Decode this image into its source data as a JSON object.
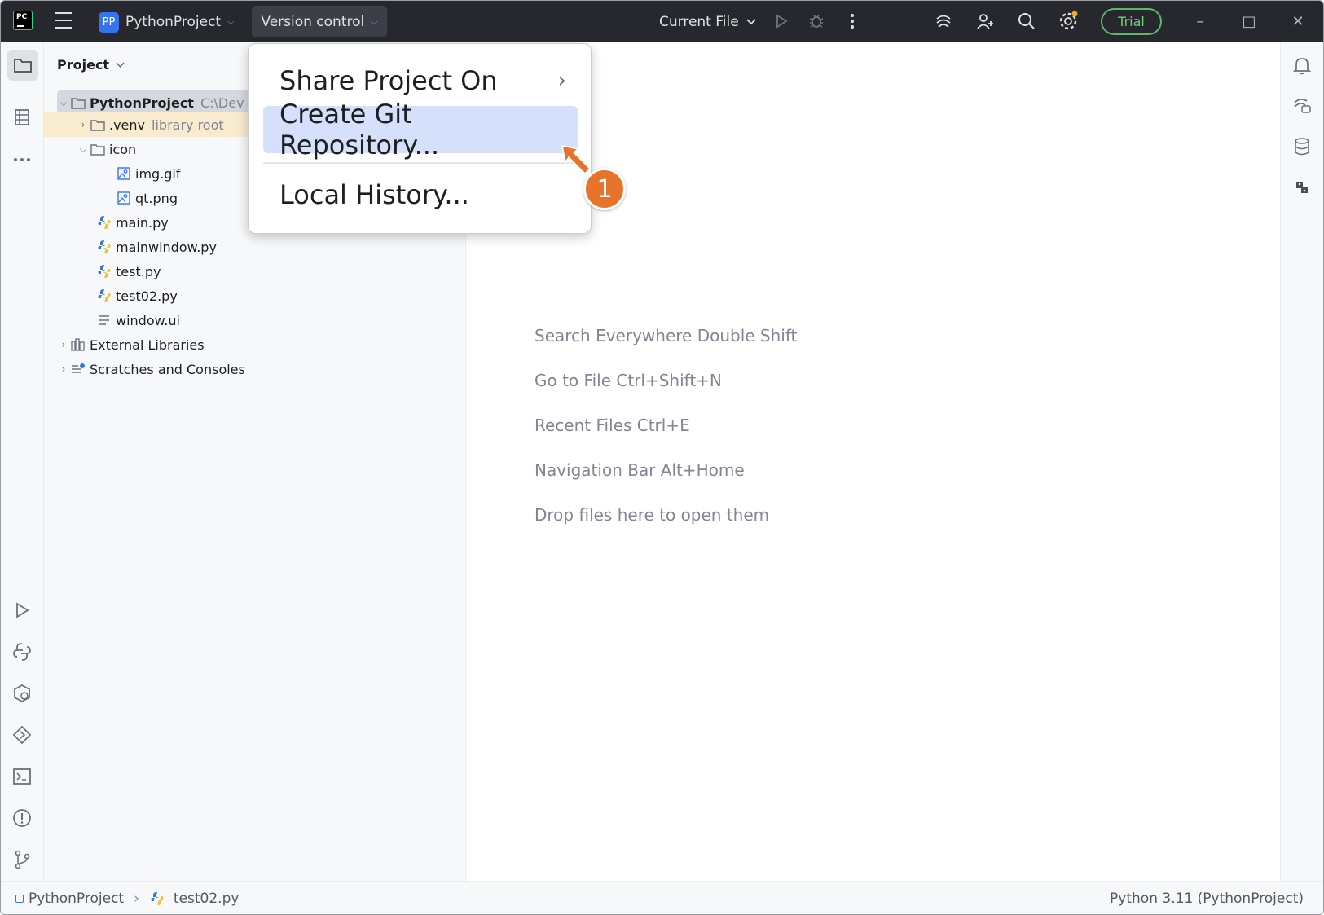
{
  "titlebar": {
    "logo_text": "PC",
    "project_badge": "PP",
    "project_name": "PythonProject",
    "vcs_label": "Version control",
    "run_config": "Current File",
    "trial_label": "Trial"
  },
  "project_panel": {
    "title": "Project",
    "tree": [
      {
        "name": "PythonProject",
        "extra": "C:\\Dev",
        "type": "folder"
      },
      {
        "name": ".venv",
        "extra": "library root",
        "type": "folder"
      },
      {
        "name": "icon",
        "type": "folder"
      },
      {
        "name": "img.gif",
        "type": "image"
      },
      {
        "name": "qt.png",
        "type": "image"
      },
      {
        "name": "main.py",
        "type": "python"
      },
      {
        "name": "mainwindow.py",
        "type": "python"
      },
      {
        "name": "test.py",
        "type": "python"
      },
      {
        "name": "test02.py",
        "type": "python"
      },
      {
        "name": "window.ui",
        "type": "text"
      },
      {
        "name": "External Libraries",
        "type": "library"
      },
      {
        "name": "Scratches and Consoles",
        "type": "scratch"
      }
    ]
  },
  "popup_menu": {
    "items": [
      {
        "label": "Share Project On",
        "has_submenu": true
      },
      {
        "label": "Create Git Repository...",
        "active": true
      },
      {
        "label": "Local History..."
      }
    ]
  },
  "annotation": {
    "step": "1",
    "color": "#e8742c"
  },
  "editor": {
    "hints": [
      "Search Everywhere Double Shift",
      "Go to File Ctrl+Shift+N",
      "Recent Files Ctrl+E",
      "Navigation Bar Alt+Home",
      "Drop files here to open them"
    ]
  },
  "statusbar": {
    "crumb_project": "PythonProject",
    "crumb_file": "test02.py",
    "interpreter": "Python 3.11 (PythonProject)"
  },
  "colors": {
    "accent": "#3574f0",
    "titlebar_bg": "#27282e",
    "selection": "#d5e1fb",
    "trial_green": "#5fb865"
  }
}
